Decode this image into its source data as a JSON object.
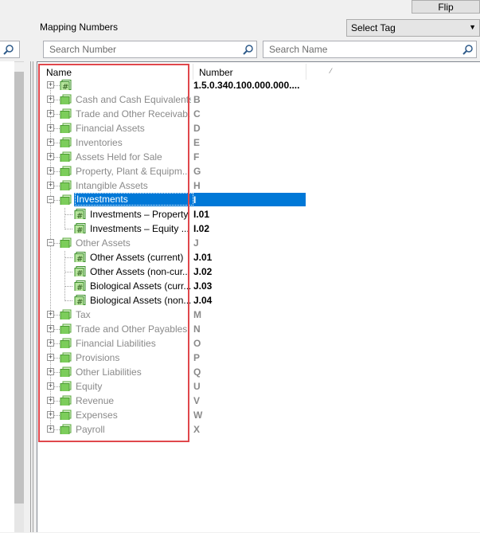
{
  "toolbar": {
    "flip_label": "Flip",
    "mapping_numbers_label": "Mapping Numbers",
    "select_tag_value": "Select Tag"
  },
  "search": {
    "number_placeholder": "Search Number",
    "name_placeholder": "Search Name"
  },
  "grid": {
    "col_name": "Name",
    "col_number": "Number",
    "rows": [
      {
        "name": "",
        "number": "1.5.0.340.100.000.000...."
      },
      {
        "name": "Cash and Cash Equivalents",
        "number": "B"
      },
      {
        "name": "Trade and Other Receivab...",
        "number": "C"
      },
      {
        "name": "Financial Assets",
        "number": "D"
      },
      {
        "name": "Inventories",
        "number": "E"
      },
      {
        "name": "Assets Held for Sale",
        "number": "F"
      },
      {
        "name": "Property, Plant & Equipm...",
        "number": "G"
      },
      {
        "name": "Intangible Assets",
        "number": "H"
      },
      {
        "name": "Investments",
        "number": "I"
      },
      {
        "name": "Investments – Property",
        "number": "I.01"
      },
      {
        "name": "Investments – Equity ...",
        "number": "I.02"
      },
      {
        "name": "Other Assets",
        "number": "J"
      },
      {
        "name": "Other Assets (current)",
        "number": "J.01"
      },
      {
        "name": "Other Assets (non-cur...",
        "number": "J.02"
      },
      {
        "name": "Biological Assets (curr...",
        "number": "J.03"
      },
      {
        "name": "Biological Assets (non...",
        "number": "J.04"
      },
      {
        "name": "Tax",
        "number": "M"
      },
      {
        "name": "Trade and Other Payables",
        "number": "N"
      },
      {
        "name": "Financial Liabilities",
        "number": "O"
      },
      {
        "name": "Provisions",
        "number": "P"
      },
      {
        "name": "Other Liabilities",
        "number": "Q"
      },
      {
        "name": "Equity",
        "number": "U"
      },
      {
        "name": "Revenue",
        "number": "V"
      },
      {
        "name": "Expenses",
        "number": "W"
      },
      {
        "name": "Payroll",
        "number": "X"
      }
    ]
  },
  "colors": {
    "selection": "#0078d7",
    "folder_green": "#7ccd5b",
    "highlight_border": "#e0474c"
  }
}
